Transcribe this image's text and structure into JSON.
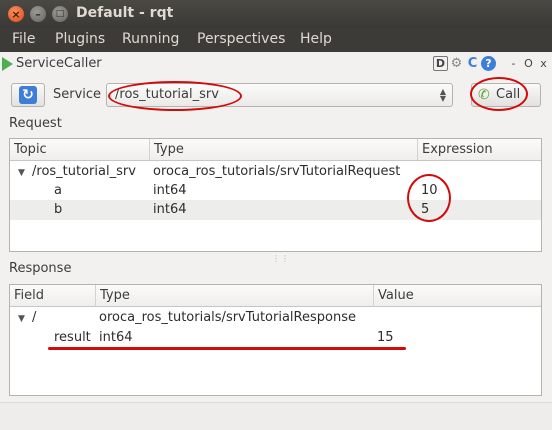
{
  "window": {
    "title": "Default - rqt",
    "close_glyph": "×",
    "min_glyph": "–",
    "max_glyph": "□"
  },
  "menu": [
    "File",
    "Plugins",
    "Running",
    "Perspectives",
    "Help"
  ],
  "plugin": {
    "title": "ServiceCaller",
    "header_icons": {
      "d": "D",
      "gear": "⚙",
      "reload": "C",
      "help": "?",
      "min": "-",
      "close": "O",
      "x": "x"
    }
  },
  "service_row": {
    "refresh_glyph": "↻",
    "label": "Service",
    "selected": "/ros_tutorial_srv",
    "call_label": "Call",
    "call_icon": "✆"
  },
  "request": {
    "label": "Request",
    "columns": [
      "Topic",
      "Type",
      "Expression"
    ],
    "root": {
      "topic": "/ros_tutorial_srv",
      "type": "oroca_ros_tutorials/srvTutorialRequest",
      "expression": ""
    },
    "rows": [
      {
        "topic": "a",
        "type": "int64",
        "expression": "10"
      },
      {
        "topic": "b",
        "type": "int64",
        "expression": "5"
      }
    ]
  },
  "response": {
    "label": "Response",
    "columns": [
      "Field",
      "Type",
      "Value"
    ],
    "root": {
      "field": "/",
      "type": "oroca_ros_tutorials/srvTutorialResponse",
      "value": ""
    },
    "rows": [
      {
        "field": "result",
        "type": "int64",
        "value": "15"
      }
    ]
  },
  "tree_expanded_glyph": "▼",
  "splitter_glyph": "⋮⋮",
  "colors": {
    "annotation": "#d10a0a",
    "titlebar": "#3c3b37",
    "accent": "#3f7ed8"
  }
}
